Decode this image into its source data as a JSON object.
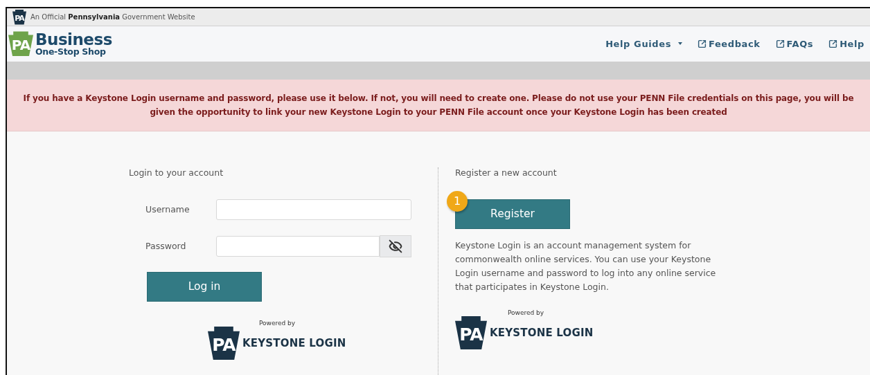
{
  "official_banner": {
    "mark": "PA",
    "text": "An Official **Pennsylvania** Government Website"
  },
  "header": {
    "logo": {
      "mark": "PA",
      "title": "Business",
      "subtitle": "One-Stop Shop"
    },
    "nav": [
      {
        "label": "Help Guides",
        "kind": "dropdown"
      },
      {
        "label": "Feedback",
        "kind": "external"
      },
      {
        "label": "FAQs",
        "kind": "external"
      },
      {
        "label": "Help",
        "kind": "external"
      }
    ]
  },
  "alert": "If you have a Keystone Login username and password, please use it below. If not, you will need to create one. Please do not use your PENN File credentials on this page, you will be given the opportunity to link your new Keystone Login to your PENN File account once your Keystone Login has been created",
  "login": {
    "heading": "Login to your account",
    "fields": [
      {
        "label": "Username",
        "kind": "text"
      },
      {
        "label": "Password",
        "kind": "password"
      }
    ],
    "button": "Log in",
    "powered": {
      "caption": "Powered by",
      "mark": "PA",
      "name": "KEYSTONE LOGIN"
    }
  },
  "register": {
    "heading": "Register a new account",
    "badge": "1",
    "button": "Register",
    "description": "Keystone Login is an account management system for commonwealth online services. You can use your Keystone Login username and password to log into any online service that participates in Keystone Login.",
    "powered": {
      "caption": "Powered by",
      "mark": "PA",
      "name": "KEYSTONE LOGIN"
    }
  }
}
